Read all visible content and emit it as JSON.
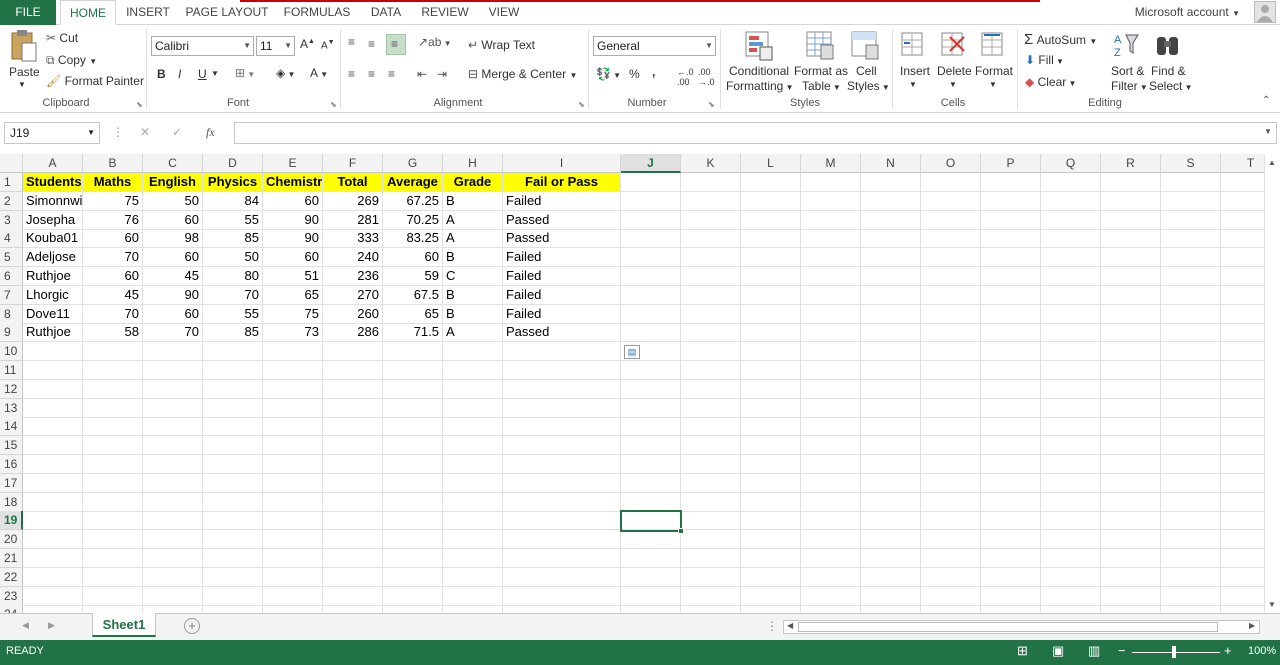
{
  "ribbon_tabs": [
    {
      "label": "FILE"
    },
    {
      "label": "HOME"
    },
    {
      "label": "INSERT"
    },
    {
      "label": "PAGE LAYOUT"
    },
    {
      "label": "FORMULAS"
    },
    {
      "label": "DATA"
    },
    {
      "label": "REVIEW"
    },
    {
      "label": "VIEW"
    }
  ],
  "account": "Microsoft account",
  "clipboard": {
    "paste": "Paste",
    "cut": "Cut",
    "copy": "Copy",
    "format_painter": "Format Painter",
    "label": "Clipboard"
  },
  "font": {
    "name": "Calibri",
    "size": "11",
    "label": "Font",
    "bold": "B",
    "italic": "I",
    "underline": "U"
  },
  "alignment": {
    "wrap_text": "Wrap Text",
    "merge_center": "Merge & Center",
    "label": "Alignment"
  },
  "number": {
    "format": "General",
    "percent": "%",
    "comma": ",",
    "label": "Number"
  },
  "styles": {
    "conditional_1": "Conditional",
    "conditional_2": "Formatting",
    "format_table_1": "Format as",
    "format_table_2": "Table",
    "cell_styles_1": "Cell",
    "cell_styles_2": "Styles",
    "label": "Styles"
  },
  "cells": {
    "insert": "Insert",
    "delete": "Delete",
    "format": "Format",
    "label": "Cells"
  },
  "editing": {
    "autosum": "AutoSum",
    "fill": "Fill",
    "clear": "Clear",
    "sort_1": "Sort &",
    "sort_2": "Filter",
    "find_1": "Find &",
    "find_2": "Select",
    "label": "Editing"
  },
  "formula_bar": {
    "name_box": "J19",
    "fx": "fx",
    "value": ""
  },
  "columns": [
    "A",
    "B",
    "C",
    "D",
    "E",
    "F",
    "G",
    "H",
    "I",
    "J",
    "K",
    "L",
    "M",
    "N",
    "O",
    "P",
    "Q",
    "R",
    "S",
    "T"
  ],
  "rows": [
    "1",
    "2",
    "3",
    "4",
    "5",
    "6",
    "7",
    "8",
    "9",
    "10",
    "11",
    "12",
    "13",
    "14",
    "15",
    "16",
    "17",
    "18",
    "19",
    "20",
    "21",
    "22",
    "23",
    "24"
  ],
  "table": {
    "headers": [
      "Students",
      "Maths",
      "English",
      "Physics",
      "Chemistry",
      "Total",
      "Average",
      "Grade",
      "Fail or Pass"
    ],
    "data": [
      [
        "Simonnwi",
        "75",
        "50",
        "84",
        "60",
        "269",
        "67.25",
        "B",
        "Failed"
      ],
      [
        "Josepha",
        "76",
        "60",
        "55",
        "90",
        "281",
        "70.25",
        "A",
        "Passed"
      ],
      [
        "Kouba01",
        "60",
        "98",
        "85",
        "90",
        "333",
        "83.25",
        "A",
        "Passed"
      ],
      [
        "Adeljose",
        "70",
        "60",
        "50",
        "60",
        "240",
        "60",
        "B",
        "Failed"
      ],
      [
        "Ruthjoe",
        "60",
        "45",
        "80",
        "51",
        "236",
        "59",
        "C",
        "Failed"
      ],
      [
        "Lhorgic",
        "45",
        "90",
        "70",
        "65",
        "270",
        "67.5",
        "B",
        "Failed"
      ],
      [
        "Dove11",
        "70",
        "60",
        "55",
        "75",
        "260",
        "65",
        "B",
        "Failed"
      ],
      [
        "Ruthjoe",
        "58",
        "70",
        "85",
        "73",
        "286",
        "71.5",
        "A",
        "Passed"
      ]
    ]
  },
  "sheet_tabs": [
    {
      "label": "Sheet1"
    }
  ],
  "status": {
    "ready": "READY",
    "zoom": "100%"
  },
  "colors": {
    "excel_green": "#217346",
    "header_fill": "#ffff00"
  }
}
